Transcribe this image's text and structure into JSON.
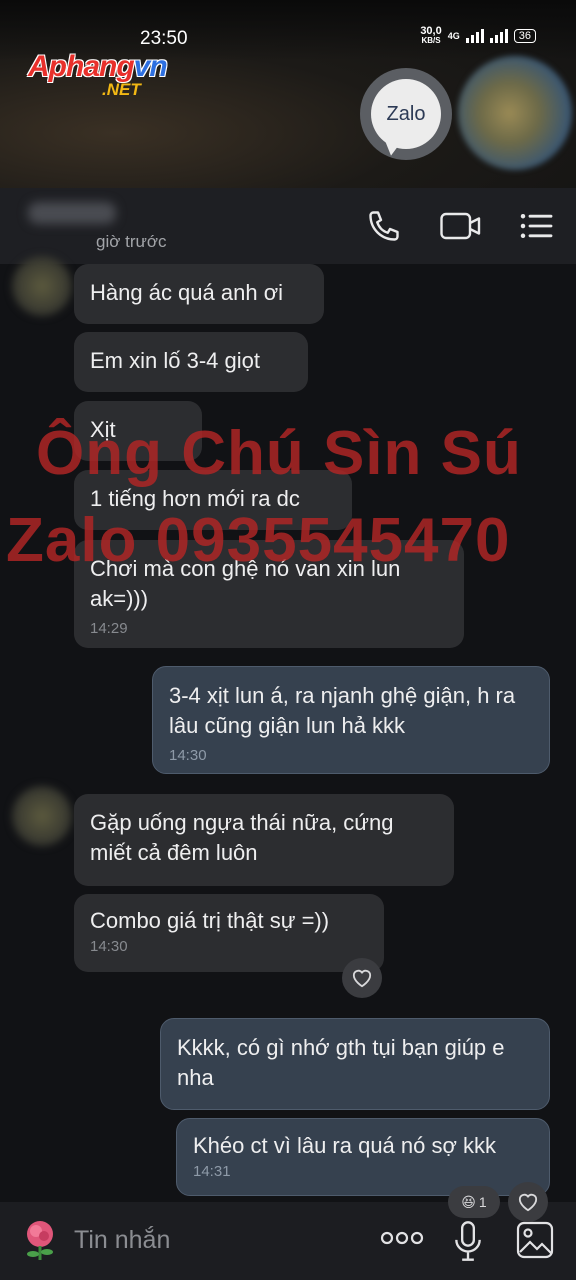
{
  "status_bar": {
    "time": "23:50",
    "net_speed": "30,0",
    "net_unit": "KB/S",
    "signal_type": "4G",
    "battery": "36"
  },
  "watermark_logo": {
    "main": "Aphangvn",
    "sub": ".NET"
  },
  "zalo_button": {
    "label": "Zalo"
  },
  "header": {
    "last_seen": "giờ trước"
  },
  "messages": [
    {
      "text": "Hàng ác quá anh ơi"
    },
    {
      "text": "Em xin lố 3-4 giọt"
    },
    {
      "text": "Xịt"
    },
    {
      "text": "1 tiếng hơn mới ra dc"
    },
    {
      "text": "Chơi mà con ghệ nó van xin lun ak=)))",
      "time": "14:29"
    },
    {
      "text": "3-4 xịt lun á, ra njanh ghệ giận, h ra lâu cũng giận lun hả kkk",
      "time": "14:30"
    },
    {
      "text": "Gặp uống ngựa thái nữa, cứng miết cả đêm luôn"
    },
    {
      "text": "Combo giá trị thật sự =))",
      "time": "14:30"
    },
    {
      "text": "Kkkk, có gì nhớ gth tụi bạn giúp e nha"
    },
    {
      "text": "Khéo ct vì lâu ra quá nó sợ kkk",
      "time": "14:31"
    }
  ],
  "reaction_count": "1",
  "overlay_watermark": {
    "line1": "Ông Chú Sìn Sú",
    "line2": "Zalo 0935545470"
  },
  "input": {
    "placeholder": "Tin nhắn"
  },
  "colors": {
    "incoming": "#2c2d30",
    "outgoing": "#36414f",
    "watermark": "#b22626"
  }
}
